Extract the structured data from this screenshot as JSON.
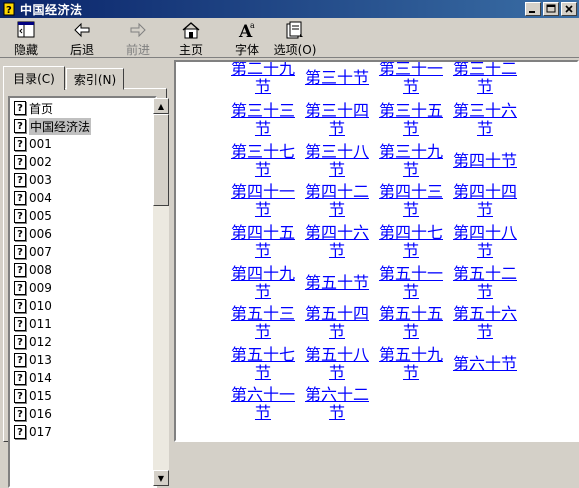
{
  "window": {
    "title": "中国经济法"
  },
  "toolbar": {
    "buttons": [
      {
        "label": "隐藏",
        "icon": "hide-icon"
      },
      {
        "label": "后退",
        "icon": "back-arrow-icon"
      },
      {
        "label": "前进",
        "icon": "forward-arrow-icon"
      },
      {
        "label": "主页",
        "icon": "home-icon"
      },
      {
        "label": "字体",
        "icon": "font-icon"
      },
      {
        "label": "选项(O)",
        "icon": "options-icon"
      }
    ]
  },
  "tabs": {
    "contents": "目录(C)",
    "index": "索引(N)"
  },
  "tree": {
    "items": [
      "首页",
      "中国经济法",
      "001",
      "002",
      "003",
      "004",
      "005",
      "006",
      "007",
      "008",
      "009",
      "010",
      "011",
      "012",
      "013",
      "014",
      "015",
      "016",
      "017"
    ],
    "selected_index": 1
  },
  "content": {
    "sections": [
      [
        "第二十九节",
        "第三十节",
        "第三十一节",
        "第三十二节"
      ],
      [
        "第三十三节",
        "第三十四节",
        "第三十五节",
        "第三十六节"
      ],
      [
        "第三十七节",
        "第三十八节",
        "第三十九节",
        "第四十节"
      ],
      [
        "第四十一节",
        "第四十二节",
        "第四十三节",
        "第四十四节"
      ],
      [
        "第四十五节",
        "第四十六节",
        "第四十七节",
        "第四十八节"
      ],
      [
        "第四十九节",
        "第五十节",
        "第五十一节",
        "第五十二节"
      ],
      [
        "第五十三节",
        "第五十四节",
        "第五十五节",
        "第五十六节"
      ],
      [
        "第五十七节",
        "第五十八节",
        "第五十九节",
        "第六十节"
      ],
      [
        "第六十一节",
        "第六十二节"
      ]
    ]
  },
  "colors": {
    "link": "#0000ff",
    "titlebar": "#0a246a",
    "face": "#d4d0c8"
  }
}
